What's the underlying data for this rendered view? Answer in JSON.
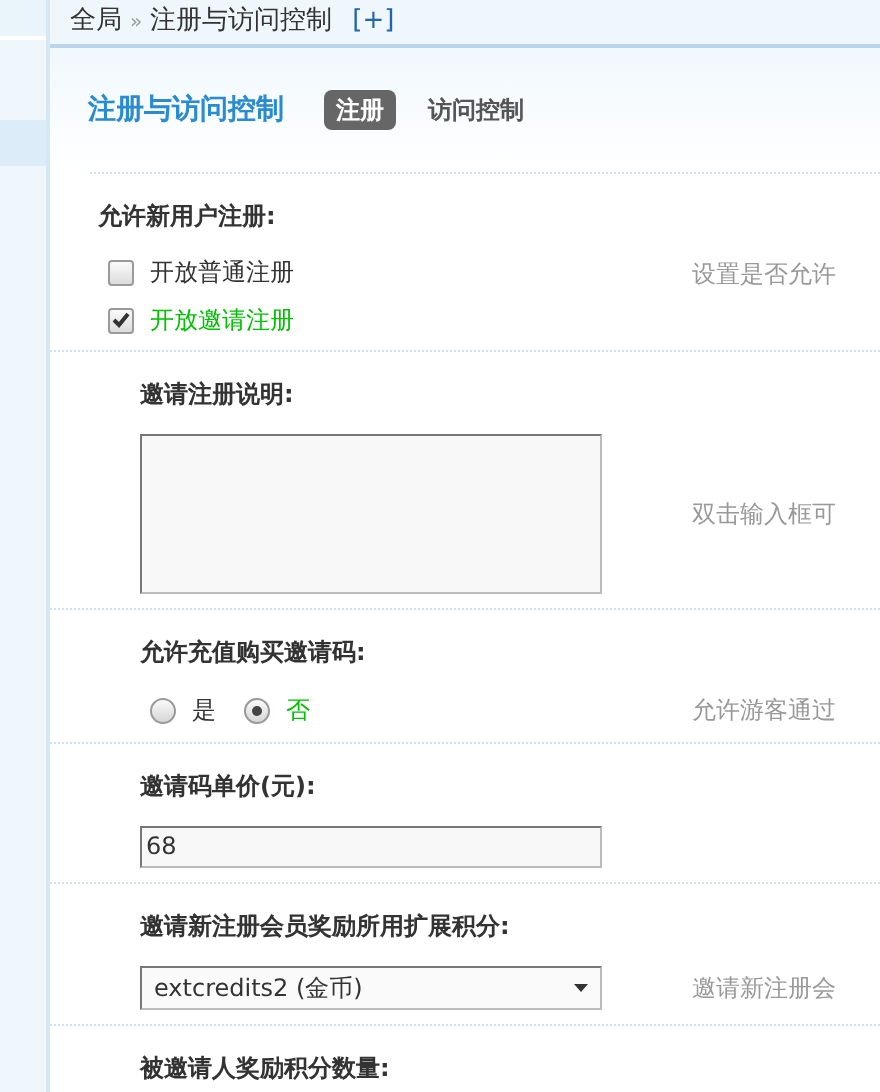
{
  "breadcrumb": {
    "items": [
      "全局",
      "注册与访问控制"
    ],
    "separator": "»",
    "add": "[+]"
  },
  "page_title": "注册与访问控制",
  "tabs": [
    {
      "label": "注册",
      "selected": true
    },
    {
      "label": "访问控制",
      "selected": false
    }
  ],
  "settings": [
    {
      "kind": "checkboxes",
      "label": "允许新用户注册:",
      "options": [
        {
          "label": "开放普通注册",
          "checked": false
        },
        {
          "label": "开放邀请注册",
          "checked": true
        }
      ],
      "hint": "设置是否允许"
    },
    {
      "kind": "textarea",
      "label": "邀请注册说明:",
      "hint": "双击输入框可"
    },
    {
      "kind": "radios",
      "label": "允许充值购买邀请码:",
      "options": [
        {
          "label": "是",
          "selected": false
        },
        {
          "label": "否",
          "selected": true
        }
      ],
      "hint": "允许游客通过"
    },
    {
      "kind": "input",
      "label": "邀请码单价(元):",
      "value": "68"
    },
    {
      "kind": "select",
      "label": "邀请新注册会员奖励所用扩展积分:",
      "value": "extcredits2 (金币)",
      "hint": "邀请新注册会"
    },
    {
      "kind": "label_only",
      "label": "被邀请人奖励积分数量:"
    }
  ]
}
